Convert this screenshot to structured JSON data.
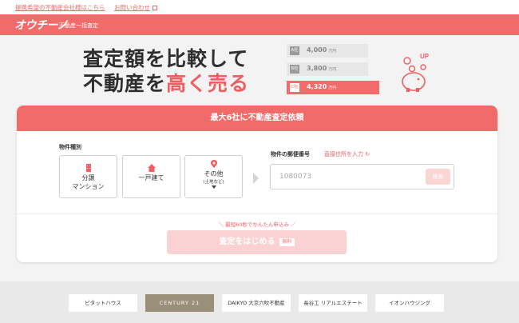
{
  "topbar": {
    "partner_link": "提携希望の不動産会社様はこちら",
    "contact_link": "お問い合わせ"
  },
  "header": {
    "logo": "オウチーノ",
    "subtitle": "不動産一括査定"
  },
  "hero": {
    "headline_line1": "査定額を比較して",
    "headline_line2_prefix": "不動産を",
    "headline_line2_highlight": "高く売る",
    "ranks": [
      {
        "badge": "A社",
        "value": "4,000",
        "unit": "万円"
      },
      {
        "badge": "B社",
        "value": "3,800",
        "unit": "万円"
      },
      {
        "badge": "C社",
        "value": "4,320",
        "unit": "万円"
      }
    ],
    "up_label": "UP"
  },
  "form": {
    "title": "最大6社に不動産査定依頼",
    "type_label": "物件種別",
    "types": [
      {
        "label1": "分譲",
        "label2": "マンション"
      },
      {
        "label1": "一戸建て"
      },
      {
        "label1": "その他",
        "small": "(土地など)"
      }
    ],
    "zip_label": "物件の郵便番号",
    "zip_link": "直接住所を入力",
    "zip_placeholder": "1080073",
    "search_button": "検索",
    "note": "＼ 最短60秒でかんたん申込み ／",
    "start_button": "査定をはじめる",
    "free_badge": "無料"
  },
  "footer": {
    "logos": [
      "ピタットハウス",
      "CENTURY 21",
      "DAIKYO 大京穴吹不動産",
      "長谷工 リアルエステート",
      "イオンハウジング"
    ]
  },
  "colors": {
    "accent": "#f26b6b",
    "accent_light": "#fbd2d2"
  }
}
